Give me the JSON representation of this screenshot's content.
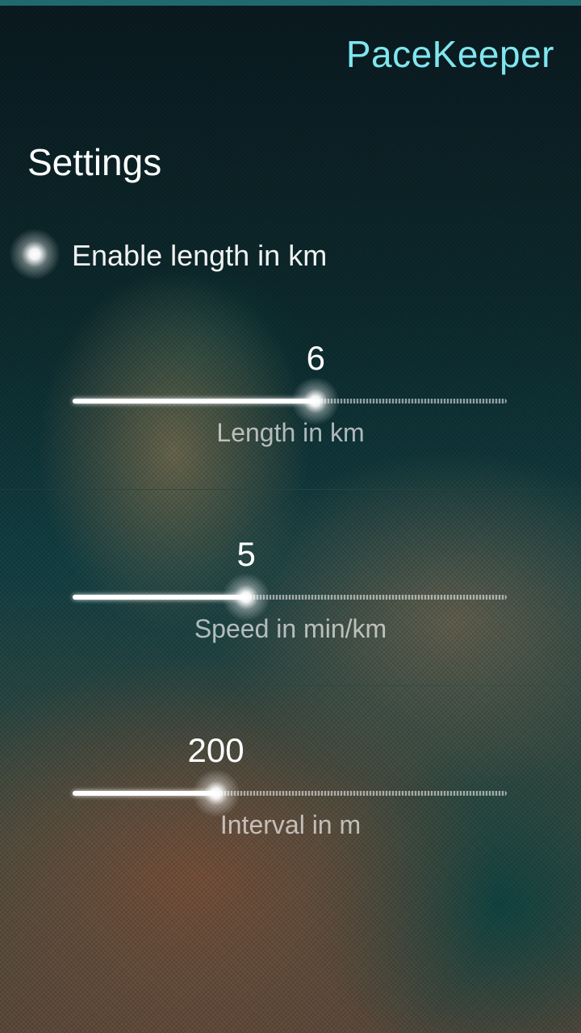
{
  "header": {
    "app_title": "PaceKeeper"
  },
  "page": {
    "title": "Settings"
  },
  "switch": {
    "label": "Enable length in km",
    "checked": true
  },
  "sliders": [
    {
      "value": "6",
      "label": "Length in km",
      "fraction": 0.56
    },
    {
      "value": "5",
      "label": "Speed in min/km",
      "fraction": 0.4
    },
    {
      "value": "200",
      "label": "Interval in m",
      "fraction": 0.33
    }
  ],
  "colors": {
    "accent": "#7fe6ee",
    "top_bar": "#1f6a6e",
    "text": "#ffffff"
  }
}
